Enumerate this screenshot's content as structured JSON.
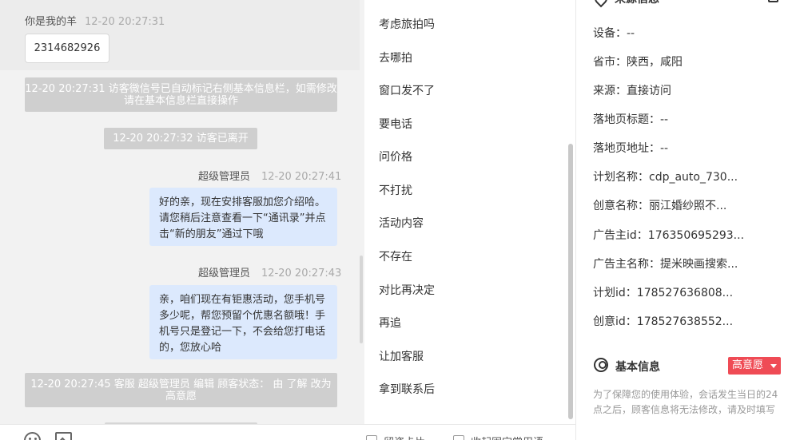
{
  "chat": {
    "visitor_name": "你是我的羊",
    "visitor_time": "12-20 20:27:31",
    "visitor_message": "2314682926",
    "system_messages": [
      "12-20 20:27:31 访客微信号已自动标记右侧基本信息栏，如需修改请在基本信息栏直接操作",
      "12-20 20:27:32 访客已离开",
      "12-20 20:27:45 客服 超级管理员 编辑 顾客状态： 由 了解 改为 高意愿"
    ],
    "agent_messages": [
      {
        "name": "超级管理员",
        "time": "12-20 20:27:41",
        "text": "好的亲，现在安排客服加您介绍哈。请您稍后注意查看一下“通讯录”并点击“新的朋友”通过下哦"
      },
      {
        "name": "超级管理员",
        "time": "12-20 20:27:43",
        "text": "亲，咱们现在有钜惠活动，您手机号多少呢，帮您预留个优惠名额哦！手机号只是登记一下，不会给您打电话的，您放心哈"
      }
    ],
    "bottom": {
      "checkbox1_label": "留资卡片",
      "checkbox2_label": "收起固定常用语",
      "icons": [
        "emoji-icon",
        "image-icon"
      ]
    }
  },
  "quick_replies": [
    "考虑旅拍吗",
    "去哪拍",
    "窗口发不了",
    "要电话",
    "问价格",
    "不打扰",
    "活动内容",
    "不存在",
    "对比再决定",
    "再追",
    "让加客服",
    "拿到联系后"
  ],
  "info": {
    "source_title": "来源信息",
    "rows": [
      {
        "label": "设备：",
        "value": "--"
      },
      {
        "label": "省市：",
        "value": "陕西，咸阳"
      },
      {
        "label": "来源：",
        "value": "直接访问"
      },
      {
        "label": "落地页标题：",
        "value": "--"
      },
      {
        "label": "落地页地址：",
        "value": "--"
      },
      {
        "label": "计划名称：",
        "value": "cdp_auto_730..."
      },
      {
        "label": "创意名称：",
        "value": "丽江婚纱照不..."
      },
      {
        "label": "广告主id：",
        "value": "176350695293..."
      },
      {
        "label": "广告主名称：",
        "value": "提米映画搜索..."
      },
      {
        "label": "计划id：",
        "value": "178527636808..."
      },
      {
        "label": "创意id：",
        "value": "178527638552..."
      }
    ],
    "basic_title": "基本信息",
    "intent_badge": "高意愿",
    "notice": "为了保障您的使用体验，会话发生当日的24点之后，顾客信息将无法修改，请及时填写"
  },
  "colors": {
    "agent_bubble": "#dce9fd",
    "system_bubble": "#cfcfcf",
    "intent_badge": "#ef4b55"
  }
}
